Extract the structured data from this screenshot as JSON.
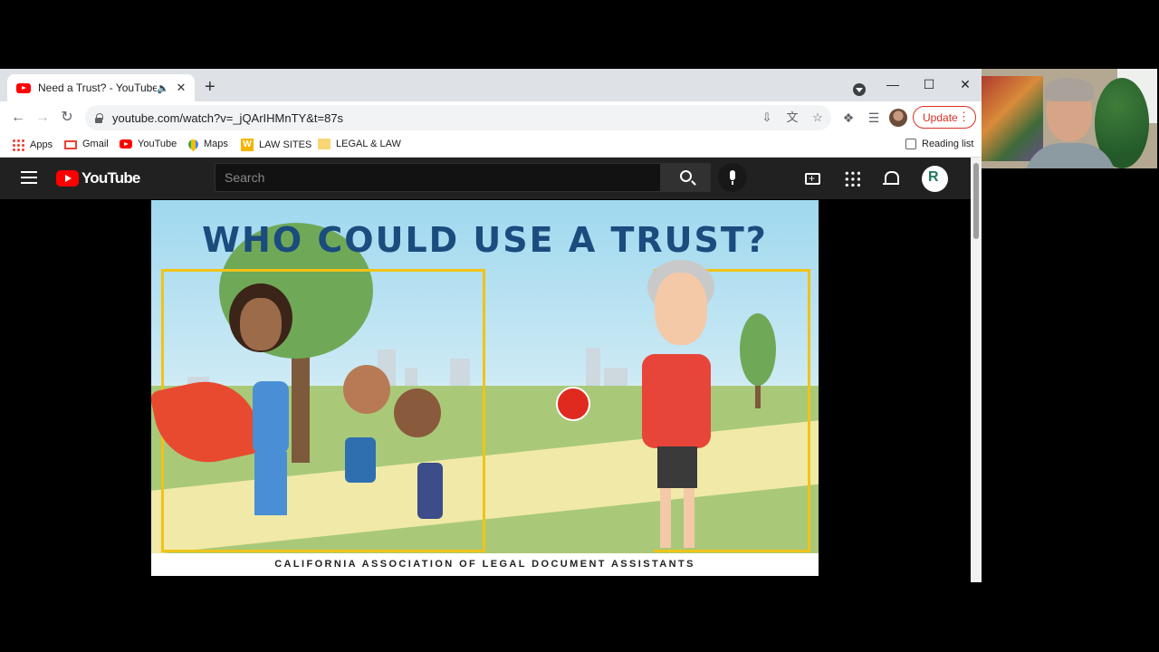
{
  "browser": {
    "tab": {
      "title": "Need a Trust? - YouTube"
    },
    "address_bar": {
      "url": "youtube.com/watch?v=_jQArIHMnTY&t=87s"
    },
    "update_button": {
      "label": "Update"
    },
    "bookmarks": [
      {
        "label": "Apps",
        "icon": "apps-grid-icon"
      },
      {
        "label": "Gmail",
        "icon": "gmail-icon"
      },
      {
        "label": "YouTube",
        "icon": "youtube-icon"
      },
      {
        "label": "Maps",
        "icon": "maps-icon"
      },
      {
        "label": "LAW SITES",
        "icon": "w-icon"
      },
      {
        "label": "LEGAL & LAW",
        "icon": "folder-icon"
      }
    ],
    "reading_list": {
      "label": "Reading list"
    }
  },
  "youtube": {
    "logo_text": "YouTube",
    "search": {
      "placeholder": "Search"
    },
    "brand_color": "#ff0000"
  },
  "video": {
    "title_text": "WHO COULD USE A TRUST?",
    "footer_text": "CALIFORNIA ASSOCIATION OF LEGAL DOCUMENT ASSISTANTS"
  }
}
